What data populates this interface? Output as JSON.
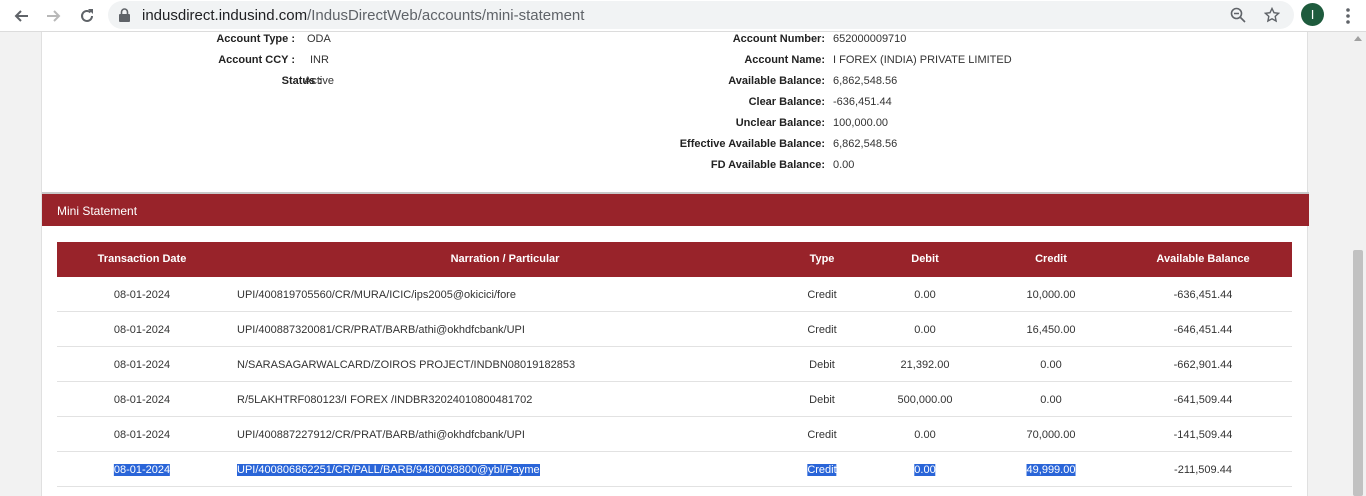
{
  "browser": {
    "url_domain": "indusdirect.indusind.com",
    "url_path": "/IndusDirectWeb/accounts/mini-statement",
    "profile_initial": "I"
  },
  "account_details": {
    "left": [
      {
        "label": "Account Type :",
        "value": "ODA"
      },
      {
        "label": "Account CCY :",
        "value": "INR"
      },
      {
        "label": "Status :",
        "value": "Active"
      }
    ],
    "right": [
      {
        "label": "Account Number:",
        "value": "652000009710"
      },
      {
        "label": "Account Name:",
        "value": "I FOREX (INDIA) PRIVATE LIMITED"
      },
      {
        "label": "Available Balance:",
        "value": "6,862,548.56"
      },
      {
        "label": "Clear Balance:",
        "value": "-636,451.44"
      },
      {
        "label": "Unclear Balance:",
        "value": "100,000.00"
      },
      {
        "label": "Effective Available Balance:",
        "value": "6,862,548.56"
      },
      {
        "label": "FD Available Balance:",
        "value": "0.00"
      }
    ]
  },
  "mini_statement": {
    "title": "Mini Statement",
    "columns": [
      "Transaction Date",
      "Narration / Particular",
      "Type",
      "Debit",
      "Credit",
      "Available Balance"
    ],
    "rows": [
      {
        "date": "08-01-2024",
        "narration": "UPI/400819705560/CR/MURA/ICIC/ips2005@okicici/fore",
        "type": "Credit",
        "debit": "0.00",
        "credit": "10,000.00",
        "balance": "-636,451.44"
      },
      {
        "date": "08-01-2024",
        "narration": "UPI/400887320081/CR/PRAT/BARB/athi@okhdfcbank/UPI",
        "type": "Credit",
        "debit": "0.00",
        "credit": "16,450.00",
        "balance": "-646,451.44"
      },
      {
        "date": "08-01-2024",
        "narration": "N/SARASAGARWALCARD/ZOIROS PROJECT/INDBN08019182853",
        "type": "Debit",
        "debit": "21,392.00",
        "credit": "0.00",
        "balance": "-662,901.44"
      },
      {
        "date": "08-01-2024",
        "narration": "R/5LAKHTRF080123/I FOREX /INDBR32024010800481702",
        "type": "Debit",
        "debit": "500,000.00",
        "credit": "0.00",
        "balance": "-641,509.44"
      },
      {
        "date": "08-01-2024",
        "narration": "UPI/400887227912/CR/PRAT/BARB/athi@okhdfcbank/UPI",
        "type": "Credit",
        "debit": "0.00",
        "credit": "70,000.00",
        "balance": "-141,509.44"
      },
      {
        "date": "08-01-2024",
        "narration": "UPI/400806862251/CR/PALL/BARB/9480098800@ybl/Payme",
        "type": "Credit",
        "debit": "0.00",
        "credit": "49,999.00",
        "balance": "-211,509.44",
        "selected": true
      }
    ]
  },
  "colors": {
    "accent": "#98232a",
    "selection": "#2a65d8"
  }
}
